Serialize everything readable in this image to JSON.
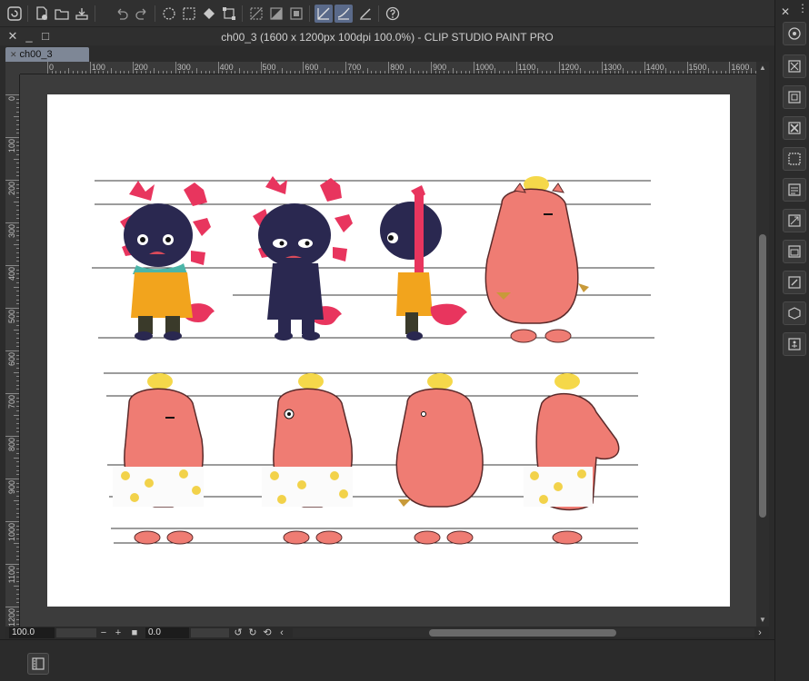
{
  "app": {
    "window_title": "ch00_3 (1600 x 1200px 100dpi 100.0%)  - CLIP STUDIO PAINT PRO"
  },
  "toolbar": {
    "buttons": [
      {
        "name": "app-menu-icon"
      },
      {
        "name": "new-file-icon"
      },
      {
        "name": "open-file-icon"
      },
      {
        "name": "save-icon"
      },
      {
        "name": "undo-icon"
      },
      {
        "name": "redo-icon"
      },
      {
        "name": "clear-icon"
      },
      {
        "name": "clear-outside-selection-icon"
      },
      {
        "name": "fill-icon"
      },
      {
        "name": "transform-icon"
      },
      {
        "name": "deselect-icon"
      },
      {
        "name": "invert-selection-icon"
      },
      {
        "name": "show-selection-icon"
      },
      {
        "name": "snap-ruler-icon"
      },
      {
        "name": "snap-special-ruler-icon"
      },
      {
        "name": "snap-grid-icon"
      },
      {
        "name": "help-icon"
      }
    ]
  },
  "tabs": [
    {
      "label": "ch00_3"
    }
  ],
  "window_controls": {
    "close": "✕",
    "minimize": "_",
    "maximize": "□"
  },
  "rulers": {
    "horizontal_labels": [
      "0",
      "100",
      "200",
      "300",
      "400",
      "500",
      "600",
      "700",
      "800",
      "900",
      "1000",
      "1100",
      "1200",
      "1300",
      "1400",
      "1500",
      "1600"
    ],
    "vertical_labels": [
      "0",
      "100",
      "200",
      "300",
      "400",
      "500",
      "600",
      "700",
      "800",
      "900",
      "1000",
      "1100",
      "1200"
    ]
  },
  "statusbar": {
    "zoom_value": "100.0",
    "zoom_out": "−",
    "zoom_in": "+",
    "angle_value": "0.0",
    "scroll_left": "‹",
    "scroll_right": "›"
  },
  "colors": {
    "ui_background": "#2b2b2b",
    "canvas": "#ffffff",
    "tab_active": "#7e8796",
    "axolotl_body": "#2a2850",
    "axolotl_gills": "#e8355e",
    "capybara_body": "#ef7c73",
    "lemon": "#f5d84a",
    "shirt_yellow": "#f2a41d",
    "scarf_teal": "#4bb5a8"
  },
  "right_panel": {
    "buttons": [
      {
        "name": "navigator-icon"
      },
      {
        "name": "layer-property-icon"
      },
      {
        "name": "layer-search-icon"
      },
      {
        "name": "sub-tool-detail-icon"
      },
      {
        "name": "material-icon"
      },
      {
        "name": "item-bank-icon"
      },
      {
        "name": "auto-action-icon"
      },
      {
        "name": "history-icon"
      },
      {
        "name": "layer-icon"
      },
      {
        "name": "3d-object-icon"
      },
      {
        "name": "animation-icon"
      }
    ]
  }
}
